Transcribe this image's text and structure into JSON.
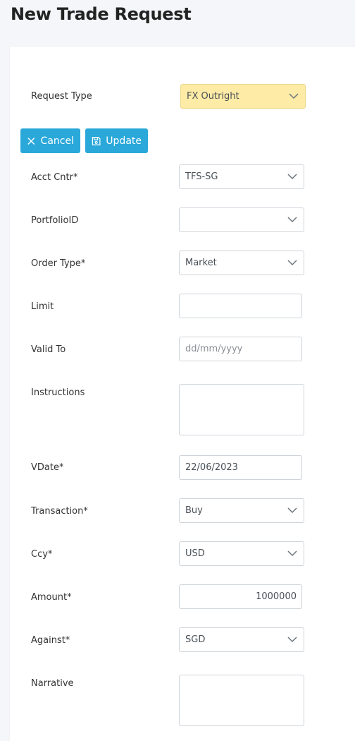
{
  "page": {
    "title": "New Trade Request"
  },
  "actions": {
    "cancel_label": "Cancel",
    "update_label": "Update"
  },
  "fields": {
    "request_type": {
      "label": "Request Type",
      "value": "FX Outright"
    },
    "acct_cntr": {
      "label": "Acct Cntr*",
      "value": "TFS-SG"
    },
    "portfolio_id": {
      "label": "PortfolioID",
      "value": ""
    },
    "order_type": {
      "label": "Order Type*",
      "value": "Market"
    },
    "limit": {
      "label": "Limit",
      "value": ""
    },
    "valid_to": {
      "label": "Valid To",
      "placeholder": "dd/mm/yyyy"
    },
    "instructions": {
      "label": "Instructions",
      "value": ""
    },
    "vdate": {
      "label": "VDate*",
      "value": "22/06/2023"
    },
    "transaction": {
      "label": "Transaction*",
      "value": "Buy"
    },
    "ccy": {
      "label": "Ccy*",
      "value": "USD"
    },
    "amount": {
      "label": "Amount*",
      "value": "1000000"
    },
    "against": {
      "label": "Against*",
      "value": "SGD"
    },
    "narrative": {
      "label": "Narrative",
      "value": ""
    }
  },
  "colors": {
    "highlight": "#fdeba6",
    "button": "#2aa8da",
    "page_bg": "#f4f6f9"
  },
  "icons": {
    "cancel": "close-icon",
    "update": "save-icon",
    "dropdown": "chevron-down-icon"
  }
}
